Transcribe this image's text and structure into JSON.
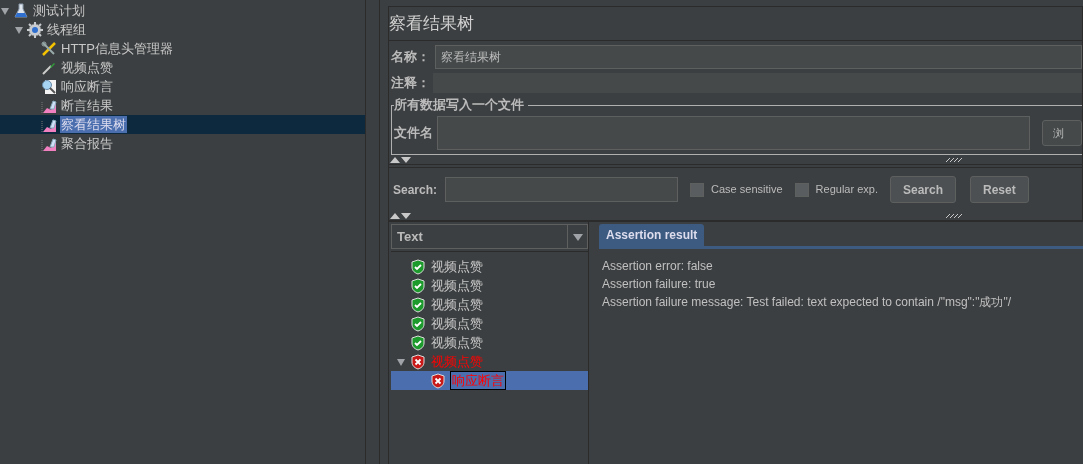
{
  "tree": [
    {
      "label": "测试计划",
      "kind": "plan",
      "expanded": true,
      "selected": false,
      "children": [
        {
          "label": "线程组",
          "kind": "threadgroup",
          "expanded": true,
          "selected": false,
          "children": [
            {
              "label": "HTTP信息头管理器",
              "kind": "config",
              "selected": false
            },
            {
              "label": "视频点赞",
              "kind": "sampler",
              "selected": false
            },
            {
              "label": "响应断言",
              "kind": "assertion",
              "selected": false
            },
            {
              "label": "断言结果",
              "kind": "listener",
              "selected": false
            },
            {
              "label": "察看结果树",
              "kind": "listener",
              "selected": true
            },
            {
              "label": "聚合报告",
              "kind": "listener",
              "selected": false
            }
          ]
        }
      ]
    }
  ],
  "panel": {
    "title": "察看结果树",
    "name_label": "名称：",
    "name_value": "察看结果树",
    "comment_label": "注释：",
    "file_group_title": "所有数据写入一个文件",
    "file_label": "文件名",
    "browse_button": "浏"
  },
  "search": {
    "label": "Search:",
    "case_sensitive": {
      "label": "Case sensitive",
      "checked": false
    },
    "regex": {
      "label": "Regular exp.",
      "checked": false
    },
    "search_button": "Search",
    "reset_button": "Reset"
  },
  "results": {
    "column": "Text",
    "items": [
      {
        "label": "视频点赞",
        "passed": true,
        "selected": false
      },
      {
        "label": "视频点赞",
        "passed": true,
        "selected": false
      },
      {
        "label": "视频点赞",
        "passed": true,
        "selected": false
      },
      {
        "label": "视频点赞",
        "passed": true,
        "selected": false
      },
      {
        "label": "视频点赞",
        "passed": true,
        "selected": false
      },
      {
        "label": "视频点赞",
        "passed": false,
        "selected": false,
        "expanded": true,
        "children": [
          {
            "label": "响应断言",
            "passed": false,
            "selected": true
          }
        ]
      }
    ]
  },
  "tabs": [
    {
      "label": "Assertion result",
      "selected": true
    }
  ],
  "assertion_lines": [
    "Assertion error: false",
    "Assertion failure: true",
    "Assertion failure message: Test failed: text expected to contain /\"msg\":\"成功\"/"
  ]
}
